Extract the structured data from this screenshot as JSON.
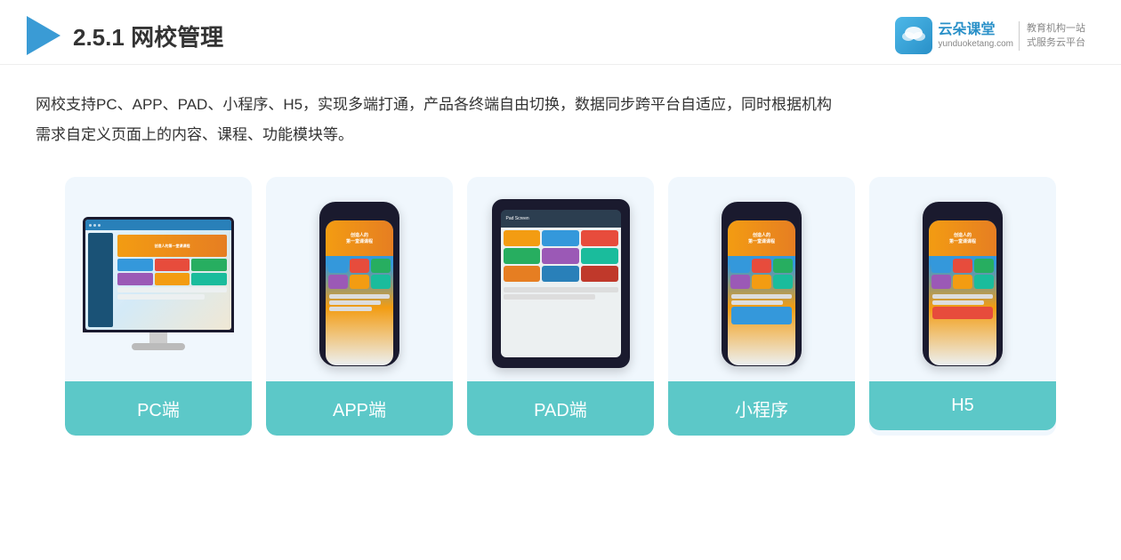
{
  "header": {
    "section_number": "2.5.1",
    "title": "网校管理",
    "brand": {
      "name": "云朵课堂",
      "domain": "yunduoketang.com",
      "slogan_line1": "教育机构一站",
      "slogan_line2": "式服务云平台"
    }
  },
  "description": {
    "text_line1": "网校支持PC、APP、PAD、小程序、H5，实现多端打通，产品各终端自由切换，数据同步跨平台自适应，同时根据机构",
    "text_line2": "需求自定义页面上的内容、课程、功能模块等。"
  },
  "cards": [
    {
      "id": "pc",
      "label": "PC端",
      "type": "pc"
    },
    {
      "id": "app",
      "label": "APP端",
      "type": "mobile"
    },
    {
      "id": "pad",
      "label": "PAD端",
      "type": "pad"
    },
    {
      "id": "miniprogram",
      "label": "小程序",
      "type": "mobile"
    },
    {
      "id": "h5",
      "label": "H5",
      "type": "mobile"
    }
  ],
  "card_label_bg": "#5cc8c8"
}
